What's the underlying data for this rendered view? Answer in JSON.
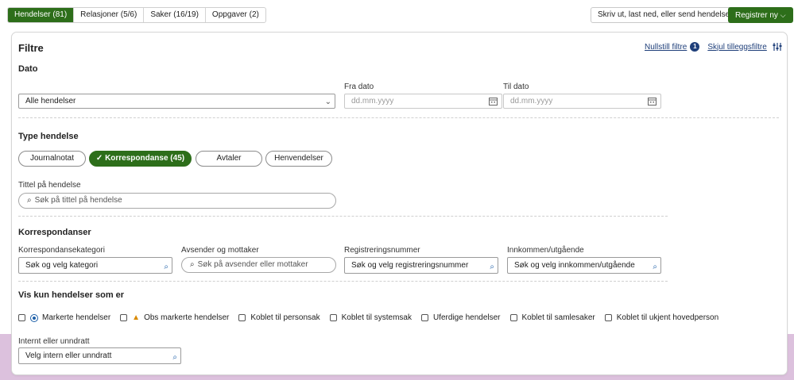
{
  "tabs": [
    {
      "label": "Hendelser",
      "count": "(81)"
    },
    {
      "label": "Relasjoner",
      "count": "(5/6)"
    },
    {
      "label": "Saker",
      "count": "(16/19)"
    },
    {
      "label": "Oppgaver",
      "count": "(2)"
    }
  ],
  "toolbar": {
    "print_label": "Skriv ut, last ned, eller send hendelser",
    "register_label": "Registrer ny",
    "chevron": "⌵"
  },
  "filters": {
    "title": "Filtre",
    "reset_label": "Nullstill filtre",
    "reset_count": "1",
    "hide_label": "Skjul tilleggsfiltre"
  },
  "dato": {
    "heading": "Dato",
    "select_value": "Alle hendelser",
    "from_label": "Fra dato",
    "from_placeholder": "dd.mm.yyyy",
    "to_label": "Til dato",
    "to_placeholder": "dd.mm.yyyy"
  },
  "type": {
    "heading": "Type hendelse",
    "chips": [
      "Journalnotat",
      "Korrespondanse (45)",
      "Avtaler",
      "Henvendelser"
    ],
    "title_label": "Tittel på hendelse",
    "title_placeholder": "Søk på tittel på hendelse"
  },
  "korr": {
    "heading": "Korrespondanser",
    "kategori_label": "Korrespondansekategori",
    "kategori_placeholder": "Søk og velg kategori",
    "avsender_label": "Avsender og mottaker",
    "avsender_placeholder": "Søk på avsender eller mottaker",
    "regnr_label": "Registreringsnummer",
    "regnr_placeholder": "Søk og velg registreringsnummer",
    "inn_label": "Innkommen/utgående",
    "inn_placeholder": "Søk og velg innkommen/utgående"
  },
  "vis": {
    "heading": "Vis kun hendelser som er",
    "options": [
      "Markerte hendelser",
      "Obs markerte hendelser",
      "Koblet til personsak",
      "Koblet til systemsak",
      "Uferdige hendelser",
      "Koblet til samlesaker",
      "Koblet til ukjent hovedperson"
    ],
    "intern_label": "Internt eller unndratt",
    "intern_placeholder": "Velg intern eller unndratt"
  },
  "colors": {
    "accent": "#2d6e1a",
    "link": "#1f3f7a",
    "band": "#dcc1dd"
  }
}
